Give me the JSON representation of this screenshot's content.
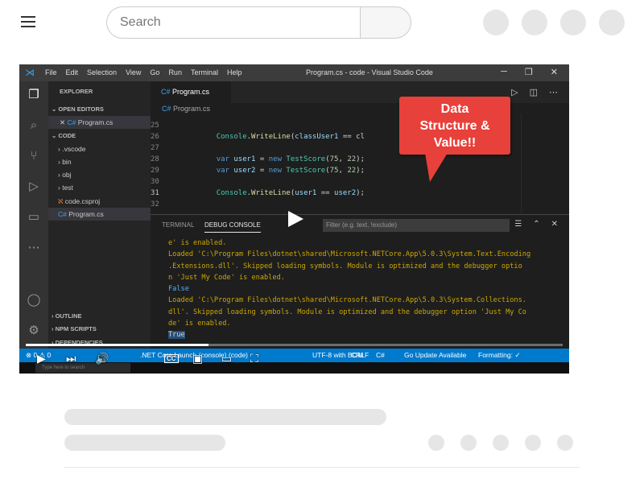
{
  "header": {
    "search_placeholder": "Search"
  },
  "video": {
    "progress": 0.34,
    "vscode": {
      "menu": [
        "File",
        "Edit",
        "Selection",
        "View",
        "Go",
        "Run",
        "Terminal",
        "Help"
      ],
      "window_title": "Program.cs - code - Visual Studio Code",
      "explorer_label": "EXPLORER",
      "open_editors_label": "OPEN EDITORS",
      "open_editor_file": "Program.cs",
      "code_folder_label": "CODE",
      "tree": [
        ".vscode",
        "bin",
        "obj",
        "test",
        "code.csproj",
        "Program.cs"
      ],
      "outline_label": "OUTLINE",
      "npm_label": "NPM SCRIPTS",
      "deps_label": "DEPENDENCIES",
      "active_tab": "Program.cs",
      "breadcrumb": "Program.cs",
      "line_numbers": [
        "25",
        "26",
        "27",
        "28",
        "29",
        "30",
        "31",
        "32"
      ],
      "panel_tabs": [
        "TERMINAL",
        "DEBUG CONSOLE"
      ],
      "filter_placeholder": "Filter (e.g. text, !exclude)",
      "console_lines": [
        "e' is enabled.",
        "Loaded 'C:\\Program Files\\dotnet\\shared\\Microsoft.NETCore.App\\5.0.3\\System.Text.Encoding",
        ".Extensions.dll'. Skipped loading symbols. Module is optimized and the debugger optio",
        "n 'Just My Code' is enabled.",
        "False",
        "Loaded 'C:\\Program Files\\dotnet\\shared\\Microsoft.NETCore.App\\5.0.3\\System.Collections.",
        "dll'. Skipped loading symbols. Module is optimized and the debugger option 'Just My Co",
        "de' is enabled.",
        "True"
      ],
      "status_items": [
        ".NET Core Launch (console) (code)",
        "UTF-8 with BOM",
        "CRLF",
        "C#",
        "Go Update Available",
        "Formatting: ✓"
      ],
      "status_left": "⊗ 0 ⚠ 0",
      "taskbar_search": "Type here to search"
    },
    "callout_lines": [
      "Data",
      "Structure &",
      "Value!!"
    ],
    "cc_label": "CC"
  }
}
